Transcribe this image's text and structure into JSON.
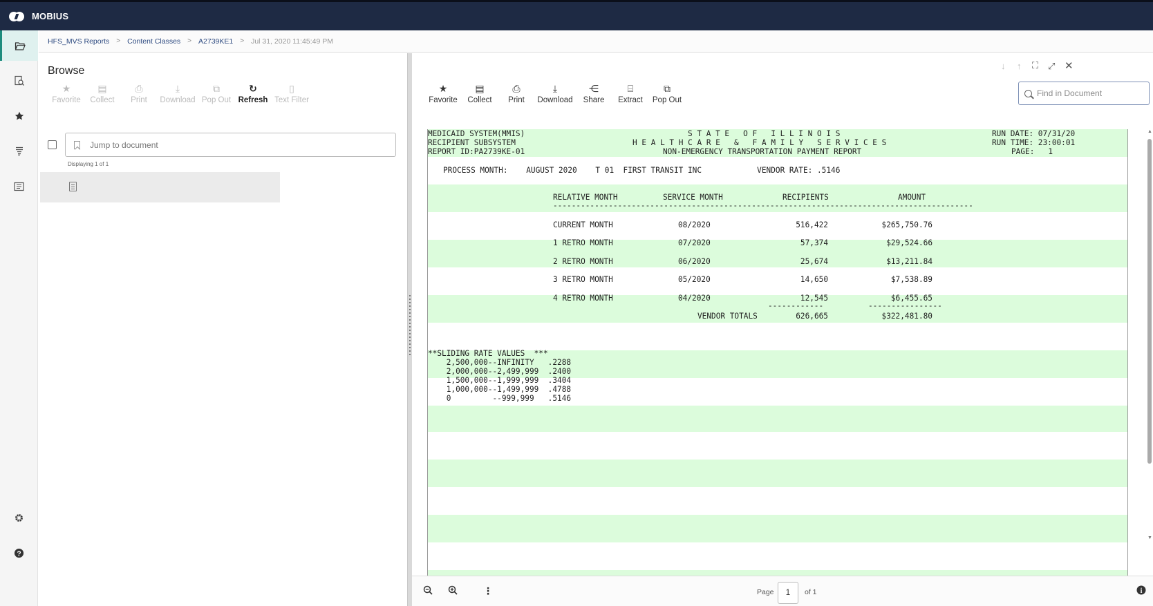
{
  "app": {
    "title": "MOBIUS"
  },
  "breadcrumb": [
    "HFS_MVS Reports",
    "Content Classes",
    "A2739KE1",
    "Jul 31, 2020 11:45:49 PM"
  ],
  "rail": {
    "items": [
      "folder-open-icon",
      "document-search-icon",
      "star-icon",
      "filter-document-icon",
      "document-list-icon",
      "gear-icon",
      "help-icon"
    ]
  },
  "browse": {
    "title": "Browse",
    "toolbar": [
      {
        "label": "Favorite",
        "icon": "star-icon",
        "enabled": false
      },
      {
        "label": "Collect",
        "icon": "collect-icon",
        "enabled": false
      },
      {
        "label": "Print",
        "icon": "printer-icon",
        "enabled": false
      },
      {
        "label": "Download",
        "icon": "download-icon",
        "enabled": false
      },
      {
        "label": "Pop Out",
        "icon": "pop-out-icon",
        "enabled": false
      },
      {
        "label": "Refresh",
        "icon": "refresh-icon",
        "enabled": true
      },
      {
        "label": "Text Filter",
        "icon": "text-filter-icon",
        "enabled": false
      }
    ],
    "jump_placeholder": "Jump to document",
    "count_text": "Displaying 1 of 1"
  },
  "viewer": {
    "toolbar": [
      {
        "label": "Favorite",
        "icon": "star-icon"
      },
      {
        "label": "Collect",
        "icon": "collect-icon"
      },
      {
        "label": "Print",
        "icon": "printer-icon"
      },
      {
        "label": "Download",
        "icon": "download-icon"
      },
      {
        "label": "Share",
        "icon": "share-icon"
      },
      {
        "label": "Extract",
        "icon": "extract-icon"
      },
      {
        "label": "Pop Out",
        "icon": "pop-out-icon"
      }
    ],
    "find_placeholder": "Find in Document",
    "page_label": "Page",
    "page_value": "1",
    "page_of": "of 1"
  },
  "report": {
    "header_left": [
      "MEDICAID SYSTEM(MMIS)",
      "RECIPIENT SUBSYSTEM",
      "REPORT ID:PA2739KE-01"
    ],
    "header_center": [
      "S T A T E   O F   I L L I N O I S",
      "H E A L T H C A R E   &   F A M I L Y   S E R V I C E S",
      "NON-EMERGENCY TRANSPORTATION PAYMENT REPORT"
    ],
    "header_right": [
      "RUN DATE: 07/31/20",
      "RUN TIME: 23:00:01",
      "PAGE:   1"
    ],
    "process_line": "PROCESS MONTH:    AUGUST 2020    T 01  FIRST TRANSIT INC            VENDOR RATE: .5146",
    "columns": [
      "RELATIVE MONTH",
      "SERVICE MONTH",
      "RECIPIENTS",
      "AMOUNT"
    ],
    "rule": "-------------------------------------------------------------------------------------------",
    "rows": [
      [
        "CURRENT MONTH",
        "08/2020",
        "516,422",
        "$265,750.76"
      ],
      [
        "1 RETRO MONTH",
        "07/2020",
        "57,374",
        "$29,524.66"
      ],
      [
        "2 RETRO MONTH",
        "06/2020",
        "25,674",
        "$13,211.84"
      ],
      [
        "3 RETRO MONTH",
        "05/2020",
        "14,650",
        "$7,538.89"
      ],
      [
        "4 RETRO MONTH",
        "04/2020",
        "12,545",
        "$6,455.65"
      ]
    ],
    "sub_rule_recipients": "------------",
    "sub_rule_amount": "----------------",
    "totals_label": "VENDOR TOTALS",
    "totals_recipients": "626,665",
    "totals_amount": "$322,481.80",
    "sliding_title": "**SLIDING RATE VALUES  ***",
    "sliding": [
      "    2,500,000--INFINITY   .2288",
      "    2,000,000--2,499,999  .2400",
      "    1,500,000--1,999,999  .3404",
      "    1,000,000--1,499,999  .4788",
      "    0         --999,999   .5146"
    ]
  }
}
